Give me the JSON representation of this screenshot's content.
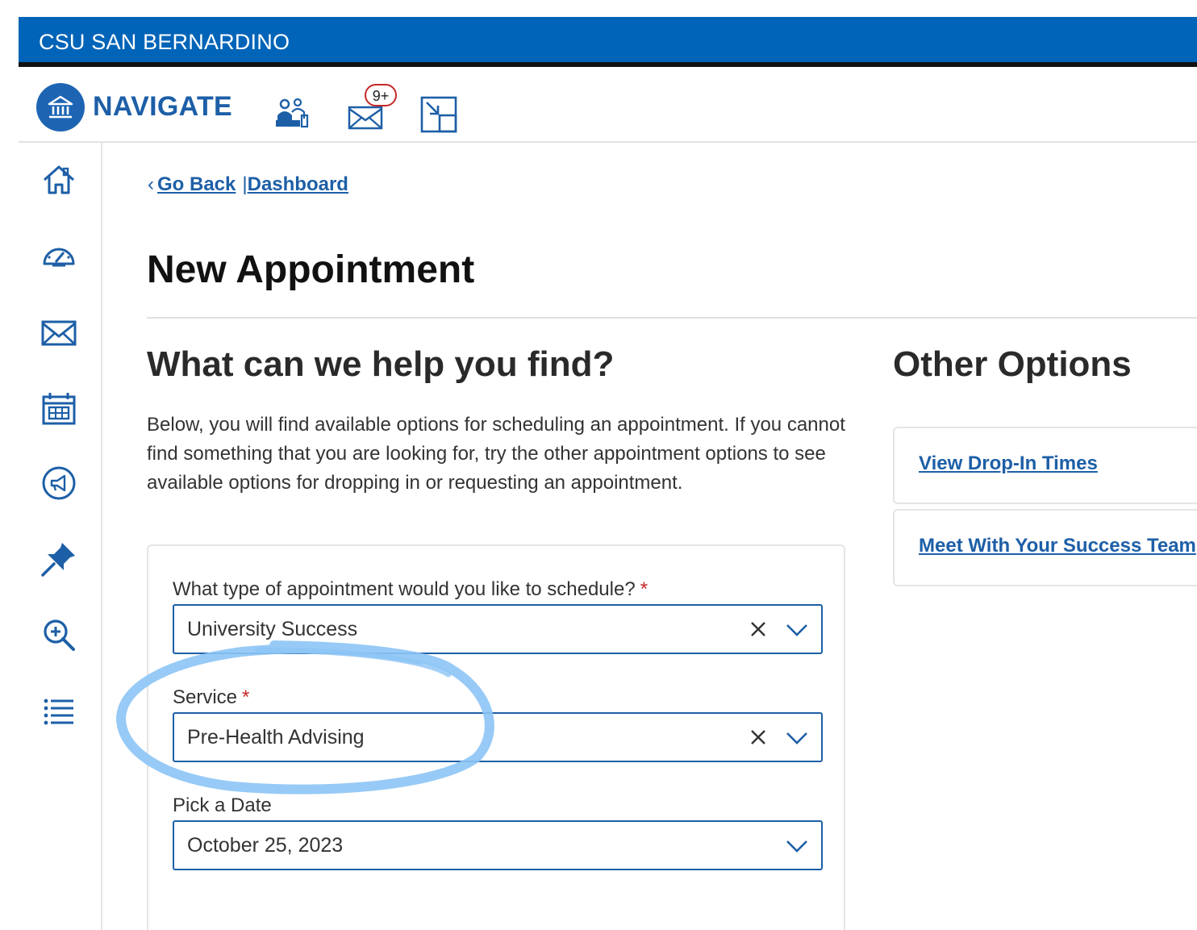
{
  "header": {
    "university": "CSU SAN BERNARDINO",
    "brand": "NAVIGATE",
    "notification_badge": "9+"
  },
  "breadcrumb": {
    "go_back": "Go Back",
    "separator": "|",
    "dashboard": "Dashboard"
  },
  "page": {
    "title": "New Appointment",
    "help_title": "What can we help you find?",
    "help_description": "Below, you will find available options for scheduling an appointment. If you cannot find something that you are looking for, try the other appointment options to see available options for dropping in or requesting an appointment."
  },
  "form": {
    "appointment_type": {
      "label": "What type of appointment would you like to schedule?",
      "required_mark": "*",
      "value": "University Success"
    },
    "service": {
      "label": "Service",
      "required_mark": "*",
      "value": "Pre-Health Advising"
    },
    "date": {
      "label": "Pick a Date",
      "value": "October 25, 2023"
    }
  },
  "other_options": {
    "title": "Other Options",
    "items": [
      {
        "label": "View Drop-In Times"
      },
      {
        "label": "Meet With Your Success Team"
      }
    ]
  },
  "colors": {
    "brand_blue": "#0064b8",
    "link_blue": "#1d5fa7",
    "required_red": "#c62828",
    "annotation_blue": "#8cc4f5"
  },
  "icons": {
    "sidebar": [
      "home-icon",
      "dashboard-gauge-icon",
      "mail-icon",
      "calendar-icon",
      "megaphone-icon",
      "pin-icon",
      "zoom-in-icon",
      "list-icon"
    ],
    "header": [
      "people-icon",
      "mail-icon",
      "resize-window-icon"
    ]
  }
}
